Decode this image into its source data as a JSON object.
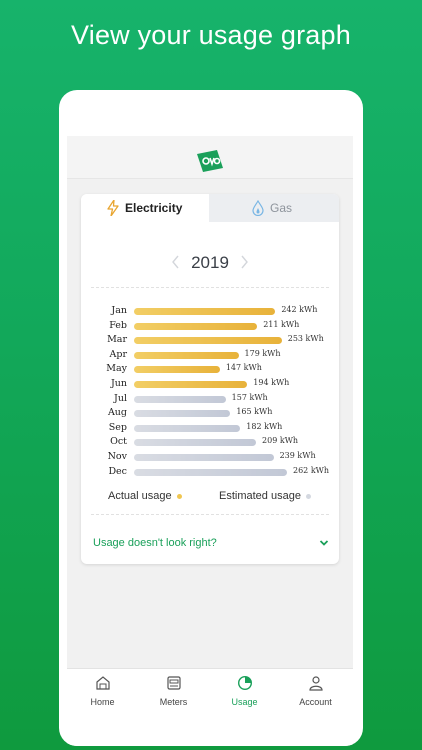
{
  "headline": "View your usage graph",
  "tabs": {
    "electricity": "Electricity",
    "gas": "Gas"
  },
  "year": "2019",
  "units": "kWh",
  "chart_data": {
    "type": "bar",
    "orientation": "horizontal",
    "categories": [
      "Jan",
      "Feb",
      "Mar",
      "Apr",
      "May",
      "Jun",
      "Jul",
      "Aug",
      "Sep",
      "Oct",
      "Nov",
      "Dec"
    ],
    "values": [
      242,
      211,
      253,
      179,
      147,
      194,
      157,
      165,
      182,
      209,
      239,
      262
    ],
    "value_labels": [
      "242 kWh",
      "211 kWh",
      "253 kWh",
      "179 kWh",
      "147 kWh",
      "194 kWh",
      "157 kWh",
      "165 kWh",
      "182 kWh",
      "209 kWh",
      "239 kWh",
      "262 kWh"
    ],
    "kind": [
      "actual",
      "actual",
      "actual",
      "actual",
      "actual",
      "actual",
      "estimated",
      "estimated",
      "estimated",
      "estimated",
      "estimated",
      "estimated"
    ],
    "xlim": [
      0,
      262
    ]
  },
  "legend": {
    "actual": "Actual usage",
    "estimated": "Estimated usage"
  },
  "colors": {
    "actual": "#e8b23a",
    "estimated": "#c2c8d6",
    "accent": "#1aa05a",
    "brand": "#1aa05a"
  },
  "help": {
    "label": "Usage doesn't look right?"
  },
  "nav": [
    {
      "label": "Home",
      "icon": "home-icon"
    },
    {
      "label": "Meters",
      "icon": "meter-icon"
    },
    {
      "label": "Usage",
      "icon": "usage-chart-icon",
      "active": true
    },
    {
      "label": "Account",
      "icon": "account-icon"
    }
  ]
}
